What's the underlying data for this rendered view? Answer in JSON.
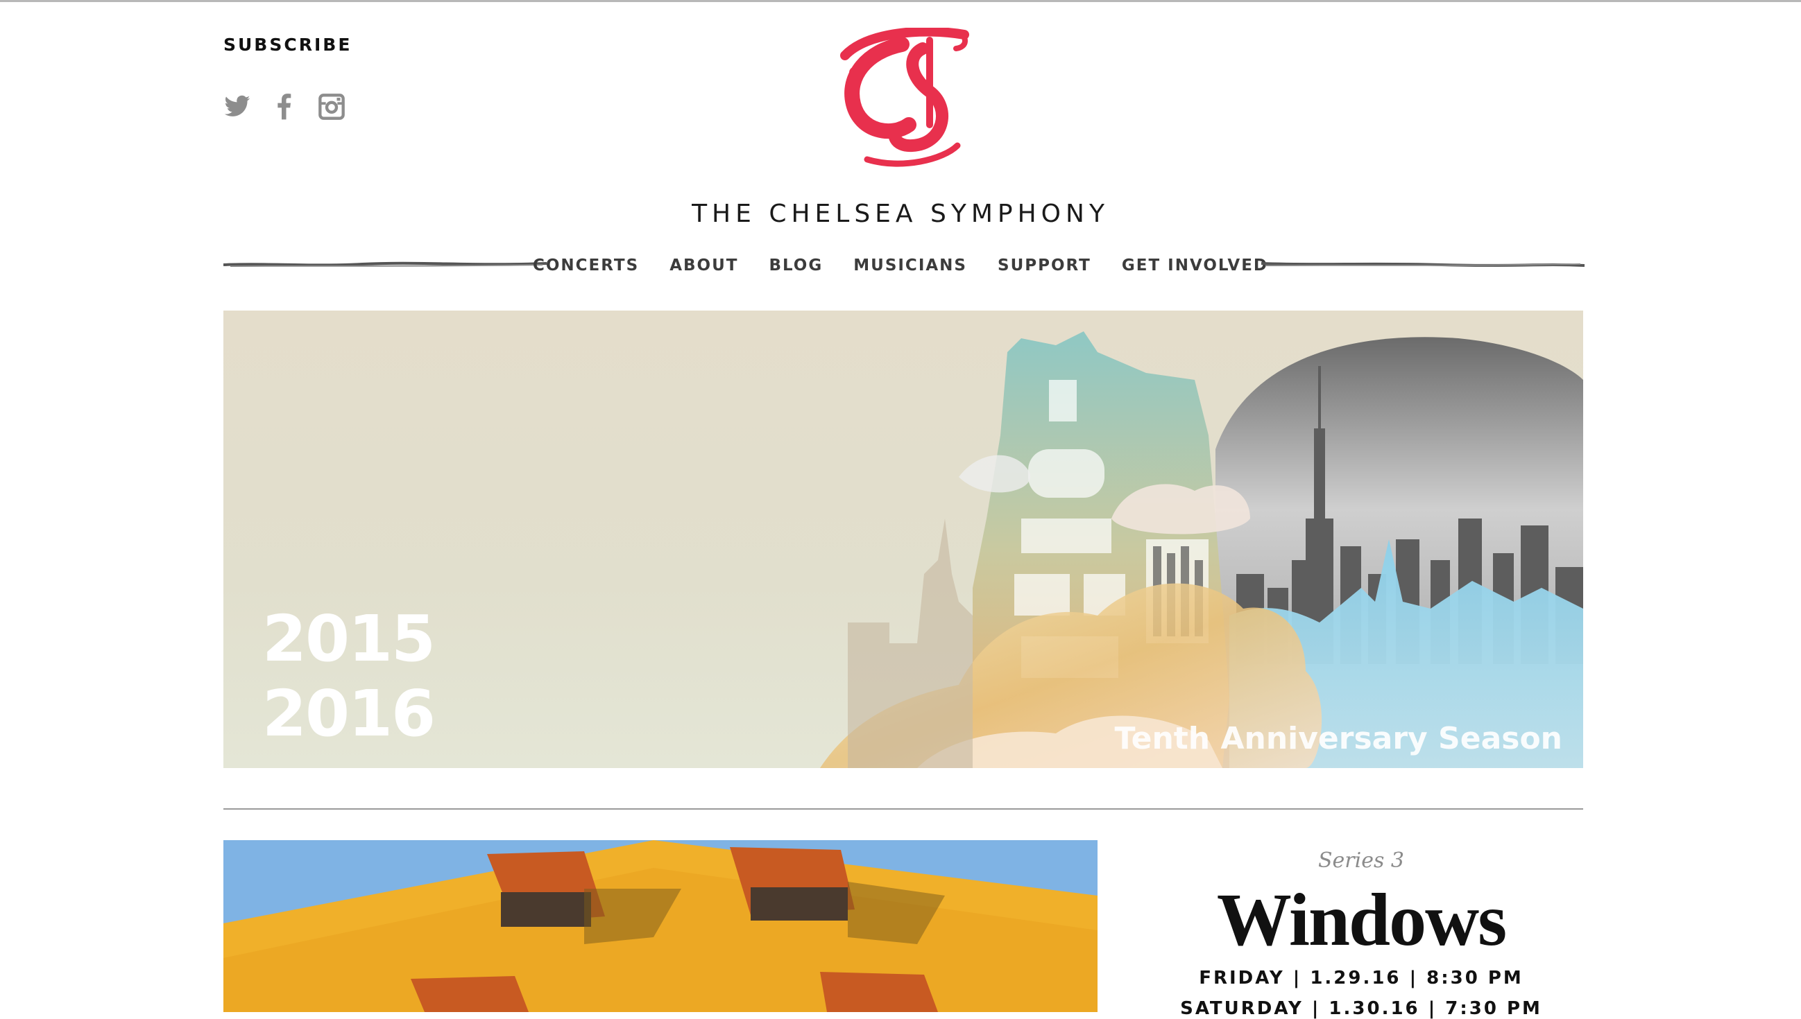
{
  "header": {
    "subscribe_label": "SUBSCRIBE",
    "social_icons": [
      "twitter-icon",
      "facebook-icon",
      "instagram-icon"
    ],
    "brand_name": "THE CHELSEA SYMPHONY",
    "logo_letters": "TCS",
    "logo_color": "#e8304d"
  },
  "nav": {
    "items": [
      "CONCERTS",
      "ABOUT",
      "BLOG",
      "MUSICIANS",
      "SUPPORT",
      "GET INVOLVED"
    ]
  },
  "hero": {
    "year_start": "2015",
    "year_end": "2016",
    "tagline": "Tenth Anniversary Season"
  },
  "event": {
    "series": "Series 3",
    "title": "Windows",
    "date_1": "FRIDAY | 1.29.16 | 8:30 PM",
    "date_2": "SATURDAY | 1.30.16 | 7:30 PM"
  }
}
